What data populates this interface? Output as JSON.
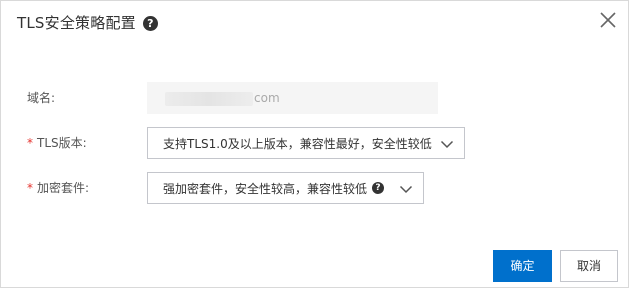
{
  "dialog": {
    "title": "TLS安全策略配置",
    "help_icon_glyph": "?",
    "close_icon": "close-x-icon"
  },
  "form": {
    "domain": {
      "label": "域名:",
      "value_suffix": "com"
    },
    "tls_version": {
      "required": "*",
      "label": "TLS版本:",
      "selected": "支持TLS1.0及以上版本，兼容性最好，安全性较低"
    },
    "cipher_suite": {
      "required": "*",
      "label": "加密套件:",
      "selected": "强加密套件，安全性较高，兼容性较低",
      "help_icon_glyph": "?"
    }
  },
  "footer": {
    "confirm_label": "确定",
    "cancel_label": "取消"
  },
  "colors": {
    "primary": "#0070cc",
    "required": "#e5322d",
    "border": "#c4c6cc"
  }
}
